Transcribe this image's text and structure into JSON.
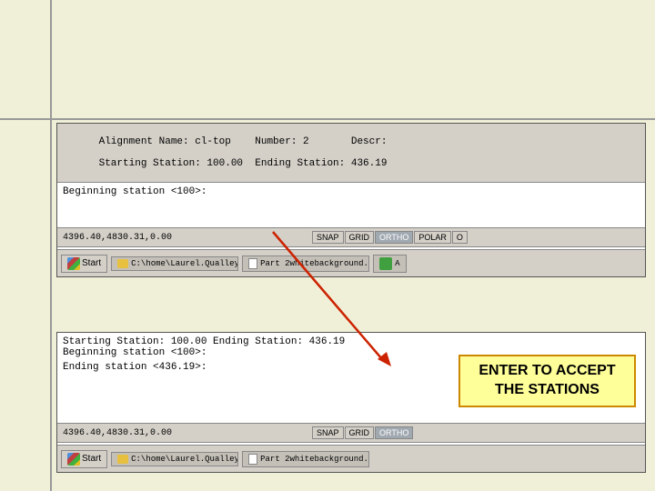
{
  "page": {
    "background_color": "#f0f0d8"
  },
  "top_panel": {
    "info_line1": "Alignment Name: cl-top    Number: 2       Descr:",
    "info_line2": "Starting Station: 100.00  Ending Station: 436.19",
    "command_prompt": "Beginning station <100>:",
    "coordinates": "4396.40,4830.31,0.00",
    "snap_buttons": [
      "SNAP",
      "GRID",
      "ORTHO",
      "POLAR",
      "O"
    ],
    "taskbar": {
      "start_label": "Start",
      "items": [
        "C:\\home\\Laurel.Qualley\\...",
        "Part 2whitebackground....",
        "A"
      ]
    }
  },
  "bottom_panel": {
    "line1": "Starting Station: 100.00  Ending Station: 436.19",
    "line2": "Beginning station <100>:",
    "command_prompt": "Ending station <436.19>:",
    "coordinates": "4396.40,4830.31,0.00",
    "snap_buttons": [
      "SNAP",
      "GRID",
      "ORTHO"
    ],
    "taskbar": {
      "start_label": "Start",
      "items": [
        "C:\\home\\Laurel.Qualley\\...",
        "Part 2whitebackground..."
      ]
    }
  },
  "tooltip": {
    "line1": "ENTER TO ACCEPT",
    "line2": "THE STATIONS"
  }
}
